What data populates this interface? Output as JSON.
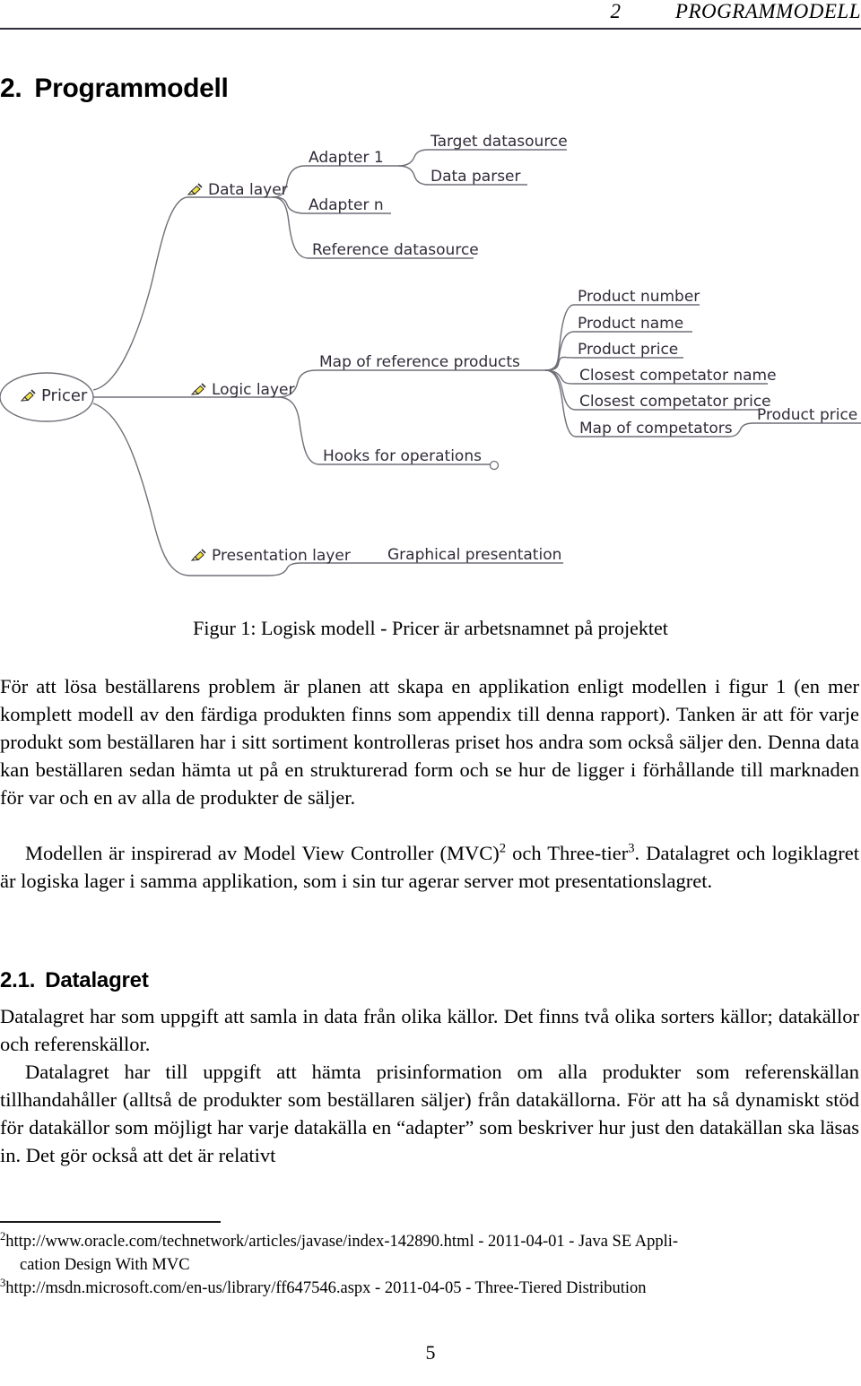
{
  "page": {
    "running_head_number": "2",
    "running_head_title": "PROGRAMMODELL",
    "page_number": "5"
  },
  "section": {
    "number": "2.",
    "title": "Programmodell"
  },
  "figure": {
    "caption": "Figur 1: Logisk modell - Pricer är arbetsnamnet på projektet",
    "diagram": {
      "type": "mind-map",
      "root": "Pricer",
      "nodes": {
        "data_layer": "Data layer",
        "adapter_1": "Adapter 1",
        "adapter_n": "Adapter n",
        "target_datasource": "Target datasource",
        "data_parser": "Data parser",
        "reference_datasource": "Reference datasource",
        "logic_layer": "Logic layer",
        "map_of_reference_products": "Map of reference products",
        "product_number": "Product number",
        "product_name": "Product name",
        "product_price": "Product price",
        "closest_competator_name": "Closest competator name",
        "closest_competator_price": "Closest competator price",
        "map_of_competators": "Map of competators",
        "competator_product_price": "Product price",
        "hooks_for_operations": "Hooks for operations",
        "presentation_layer": "Presentation layer",
        "graphical_presentation": "Graphical presentation"
      }
    }
  },
  "subsection": {
    "number": "2.1.",
    "title": "Datalagret"
  },
  "body": {
    "para_1_line_1": "För att lösa beställarens problem är planen att skapa en applikation enligt modellen i figur 1 (en mer komplett modell av den färdiga produkten finns som appendix till denna rapport). Tanken är att för varje produkt som beställaren har i sitt sortiment kontrolleras priset hos andra som också säljer den. Denna data kan beställaren sedan hämta ut på en strukturerad form och se hur de ligger i förhållande till marknaden för var och en av alla de produkter de säljer.",
    "para_2_pre": "Modellen är inspirerad av Model View Controller (MVC)",
    "para_2_mark_1": "2",
    "para_2_mid": " och Three-tier",
    "para_2_mark_2": "3",
    "para_2_post": ". Datalagret och logiklagret är logiska lager i samma applikation, som i sin tur agerar server mot presentationslagret.",
    "para_3_a": "Datalagret har som uppgift att samla in data från olika källor. Det finns två olika sorters källor; datakällor och referenskällor.",
    "para_3_b": "Datalagret har till uppgift att hämta prisinformation om alla produkter som referenskällan tillhandahåller (alltså de produkter som beställaren säljer) från datakällorna. För att ha så dynamiskt stöd för datakällor som möjligt har varje datakälla en “adapter” som beskriver hur just den datakällan ska läsas in. Det gör också att det är relativt"
  },
  "footnotes": [
    {
      "mark": "2",
      "text": "http://www.oracle.com/technetwork/articles/javase/index-142890.html - 2011-04-01 - Java SE Appli-",
      "cont": "cation Design With MVC"
    },
    {
      "mark": "3",
      "text": "http://msdn.microsoft.com/en-us/library/ff647546.aspx - 2011-04-05 - Three-Tiered Distribution",
      "cont": ""
    }
  ],
  "colors": {
    "rule": "#2c2c3a",
    "mindmap_line": "#6f6f78",
    "mindmap_text": "#312b38",
    "icon_yellow": "#f2e24a",
    "icon_dark": "#2b2b2b"
  }
}
